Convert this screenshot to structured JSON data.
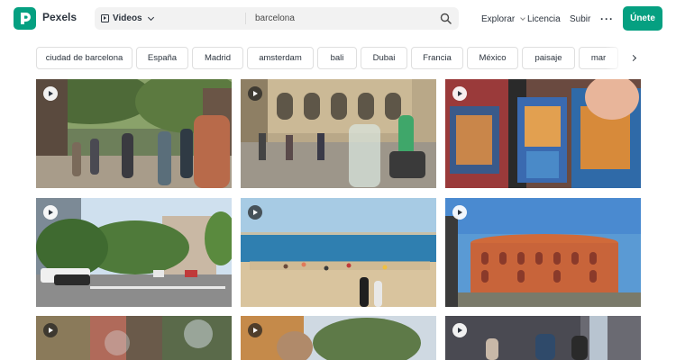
{
  "brand": {
    "name": "Pexels",
    "logo_letter": "P",
    "accent": "#05A081"
  },
  "search": {
    "type_label": "Videos",
    "type_icon": "video-icon",
    "query": "barcelona",
    "search_icon": "search-icon"
  },
  "nav": {
    "explore_label": "Explorar",
    "license_label": "Licencia",
    "upload_label": "Subir",
    "more_label": "···",
    "join_label": "Únete"
  },
  "chips": [
    "ciudad de barcelona",
    "España",
    "Madrid",
    "amsterdam",
    "bali",
    "Dubai",
    "Francia",
    "México",
    "paisaje",
    "mar"
  ],
  "results": [
    {
      "scene": "street-crowd-trees",
      "icon": "play-icon"
    },
    {
      "scene": "gaudi-facade-street",
      "icon": "play-icon"
    },
    {
      "scene": "souvenir-postcards",
      "icon": "play-icon"
    },
    {
      "scene": "avenue-trees-traffic",
      "icon": "play-icon"
    },
    {
      "scene": "barceloneta-beach",
      "icon": "play-icon"
    },
    {
      "scene": "las-arenas-bullring",
      "icon": "play-icon"
    },
    {
      "scene": "broken-glass-art",
      "icon": "play-icon"
    },
    {
      "scene": "woman-umbrella-trees",
      "icon": "play-icon"
    },
    {
      "scene": "narrow-street-people",
      "icon": "play-icon"
    }
  ]
}
